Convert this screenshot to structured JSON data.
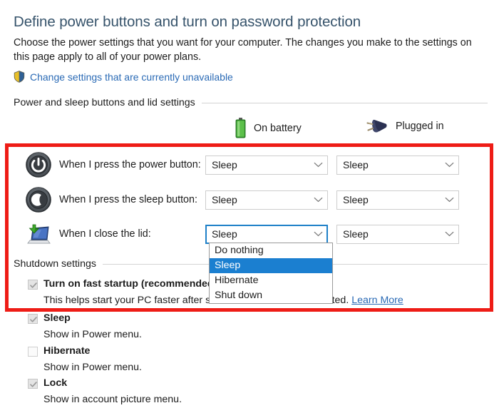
{
  "header": {
    "title": "Define power buttons and turn on password protection",
    "intro": "Choose the power settings that you want for your computer. The changes you make to the settings on this page apply to all of your power plans.",
    "uac_link": "Change settings that are currently unavailable",
    "uac_icon": "shield-icon"
  },
  "sections": {
    "power_lid": "Power and sleep buttons and lid settings",
    "shutdown": "Shutdown settings"
  },
  "columns": [
    {
      "label": "On battery",
      "icon": "battery-icon"
    },
    {
      "label": "Plugged in",
      "icon": "plug-icon"
    }
  ],
  "rows": [
    {
      "icon": "power-button-icon",
      "label": "When I press the power button:",
      "on_battery": "Sleep",
      "plugged_in": "Sleep"
    },
    {
      "icon": "sleep-button-icon",
      "label": "When I press the sleep button:",
      "on_battery": "Sleep",
      "plugged_in": "Sleep"
    },
    {
      "icon": "laptop-lid-icon",
      "label": "When I close the lid:",
      "on_battery": "Sleep",
      "plugged_in": "Sleep"
    }
  ],
  "dropdown": {
    "open": true,
    "selected": "Sleep",
    "options": [
      "Do nothing",
      "Sleep",
      "Hibernate",
      "Shut down"
    ]
  },
  "checkboxes": [
    {
      "label": "Turn on fast startup (recommended)",
      "checked": true,
      "disabled": true,
      "desc": "This helps start your PC faster after shutdown. Restart isn't affected.",
      "link": "Learn More"
    },
    {
      "label": "Sleep",
      "checked": true,
      "disabled": true,
      "desc": "Show in Power menu.",
      "link": ""
    },
    {
      "label": "Hibernate",
      "checked": false,
      "disabled": true,
      "desc": "Show in Power menu.",
      "link": ""
    },
    {
      "label": "Lock",
      "checked": true,
      "disabled": true,
      "desc": "Show in account picture menu.",
      "link": ""
    }
  ],
  "annotation": {
    "type": "red-rectangle-highlight",
    "color": "#ee1c16"
  },
  "colors": {
    "title": "#36536b",
    "link": "#2a6ab5",
    "highlight": "#1b7fd0",
    "annotation": "#ee1c16",
    "battery_green": "#4aa83a",
    "plug_navy": "#3a3f63"
  }
}
